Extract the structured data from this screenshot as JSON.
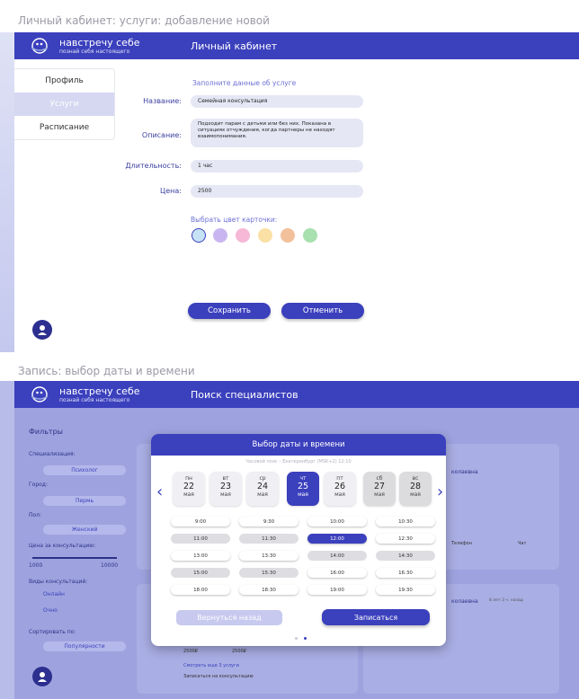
{
  "screen1": {
    "caption": "Личный кабинет: услуги: добавление новой",
    "logo": {
      "name": "навстречу себе",
      "tagline": "познай себя настоящего"
    },
    "header_title": "Личный кабинет",
    "menu": [
      "Профиль",
      "Услуги",
      "Расписание"
    ],
    "form_hint": "Заполните данные об услуге",
    "fields": {
      "name_label": "Название:",
      "name_value": "Семейная консультация",
      "desc_label": "Описание:",
      "desc_value": "Подходит парам с детьми или без них. Показана в ситуациях отчуждения, когда партнеры не находят взаимопонимания.",
      "duration_label": "Длительность:",
      "duration_value": "1 час",
      "price_label": "Цена:",
      "price_value": "2500"
    },
    "color_label": "Выбрать цвет карточки:",
    "colors": [
      "#c6e2f5",
      "#c9b6f0",
      "#f6b8d6",
      "#fbe0a6",
      "#f2c09a",
      "#a8e0b0"
    ],
    "save": "Сохранить",
    "cancel": "Отменить"
  },
  "screen2": {
    "caption": "Запись: выбор даты и времени",
    "logo": {
      "name": "навстречу себе",
      "tagline": "познай себя настоящего"
    },
    "header_title": "Поиск специалистов",
    "filters_title": "Фильтры",
    "filters": {
      "spec_label": "Специализация:",
      "spec_value": "Психолог",
      "city_label": "Город:",
      "city_value": "Пермь",
      "gender_label": "Пол:",
      "gender_value": "Женский",
      "price_label": "Цена за консультацию:",
      "price_min": "1000",
      "price_max": "10000",
      "type_label": "Виды консультаций:",
      "type_online": "Онлайн",
      "type_offline": "Очно",
      "sort_label": "Сортировать по:",
      "sort_value": "Популярности"
    },
    "modal": {
      "title": "Выбор даты и времени",
      "timezone": "Часовой пояс – Екатеринбург (MSK+2) 12:10",
      "days": [
        {
          "dow": "пн",
          "num": "22",
          "mon": "мая"
        },
        {
          "dow": "вт",
          "num": "23",
          "mon": "мая"
        },
        {
          "dow": "ср",
          "num": "24",
          "mon": "мая"
        },
        {
          "dow": "чт",
          "num": "25",
          "mon": "мая"
        },
        {
          "dow": "пт",
          "num": "26",
          "mon": "мая"
        },
        {
          "dow": "сб",
          "num": "27",
          "mon": "мая"
        },
        {
          "dow": "вс",
          "num": "28",
          "mon": "мая"
        }
      ],
      "slots": [
        "9:00",
        "9:30",
        "10:00",
        "10:30",
        "11:00",
        "11:30",
        "12:00",
        "12:30",
        "13:00",
        "13:30",
        "14:00",
        "14:30",
        "15:00",
        "15:30",
        "16:00",
        "16:30",
        "18:00",
        "18:30",
        "19:00",
        "19:30"
      ],
      "back": "Вернуться назад",
      "book": "Записаться"
    },
    "card_texts": {
      "name_suffix": "колаевна",
      "ago": "8 лет 3 ч. назад",
      "more": "Смотреть еще 3 услуги",
      "consult": "Записаться на консультацию",
      "phone": "Телефон",
      "chat": "Чат",
      "p1": "2500₽",
      "p2": "2500₽"
    }
  }
}
